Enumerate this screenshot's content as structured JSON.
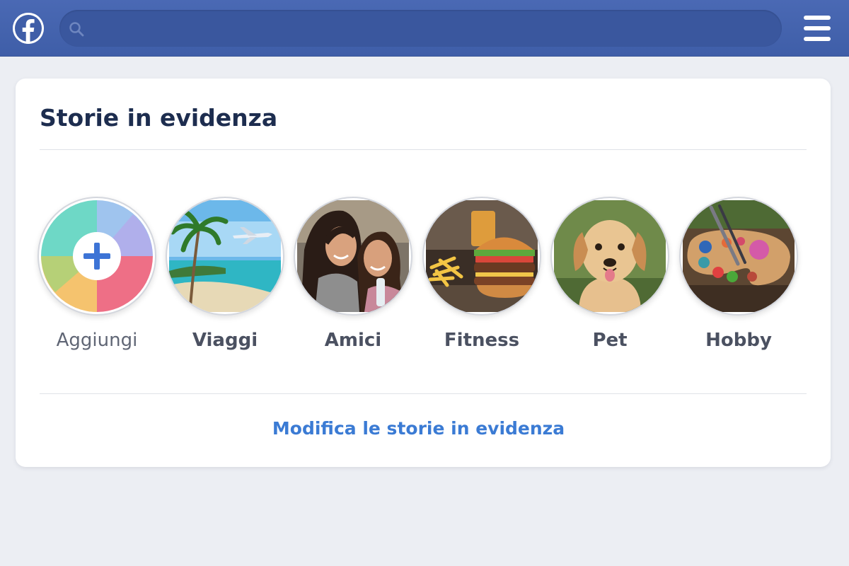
{
  "header": {
    "search_placeholder": "",
    "icons": {
      "logo": "facebook-logo",
      "search": "search-icon",
      "menu": "hamburger-menu-icon"
    },
    "colors": {
      "bar": "#4267b2",
      "search_bg": "#3a579e"
    }
  },
  "highlights": {
    "title": "Storie in evidenza",
    "items": [
      {
        "label": "Aggiungi",
        "icon": "add-plus-icon"
      },
      {
        "label": "Viaggi",
        "icon": "beach-airplane-thumbnail"
      },
      {
        "label": "Amici",
        "icon": "friends-photo-thumbnail"
      },
      {
        "label": "Fitness",
        "icon": "burger-fries-thumbnail"
      },
      {
        "label": "Pet",
        "icon": "puppy-thumbnail"
      },
      {
        "label": "Hobby",
        "icon": "paint-palette-thumbnail"
      }
    ],
    "edit_link": "Modifica le storie in evidenza",
    "colors": {
      "link": "#3b7bd4",
      "title": "#1d2d4f"
    }
  }
}
